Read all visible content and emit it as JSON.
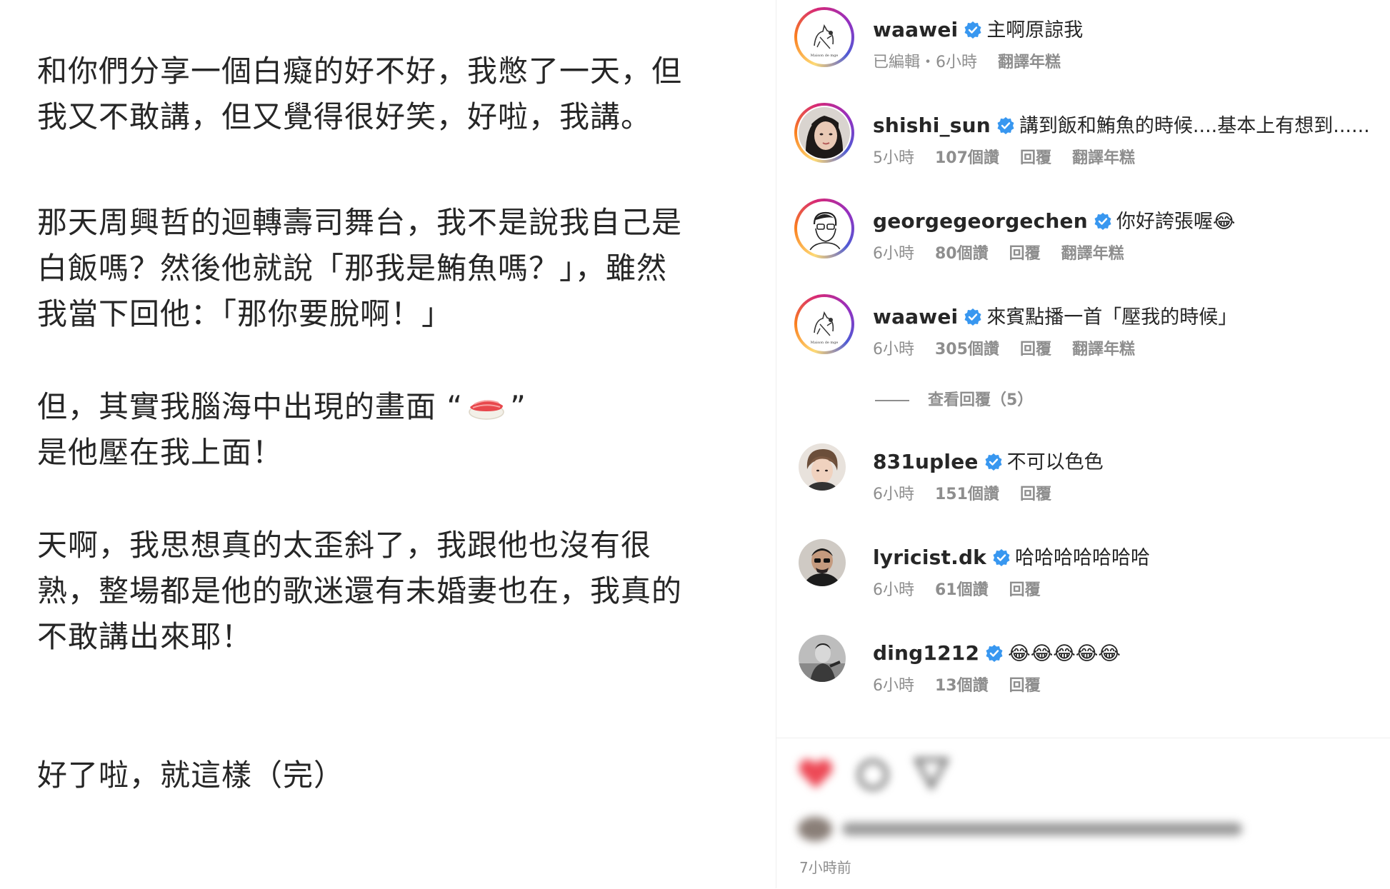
{
  "post": {
    "paragraphs": [
      [
        "和你們分享一個白癡的好不好，我憋了一天，但",
        "我又不敢講，但又覺得很好笑，好啦，我講。"
      ],
      [
        "那天周興哲的迴轉壽司舞台，我不是說我自己是",
        "白飯嗎？然後他就說「那我是鮪魚嗎？」，雖然",
        "我當下回他：「那你要脫啊！」"
      ],
      [
        "但，其實我腦海中出現的畫面 “",
        "是他壓在我上面！"
      ],
      [
        "天啊，我思想真的太歪斜了，我跟他也沒有很",
        "熟，整場都是他的歌迷還有未婚妻也在，我真的",
        "不敢講出來耶！"
      ],
      [
        "好了啦，就這樣（完）"
      ]
    ],
    "sushi_close": "”"
  },
  "comments": [
    {
      "user": "waawei",
      "text": "主啊原諒我",
      "meta": [
        "已編輯・6小時",
        "翻譯年糕"
      ],
      "avatar": "cat-sketch-avatar"
    },
    {
      "user": "shishi_sun",
      "text": "講到飯和鮪魚的時候....基本上有想到......",
      "meta": [
        "5小時",
        "107個讚",
        "回覆",
        "翻譯年糕"
      ],
      "avatar": "woman-photo-avatar"
    },
    {
      "user": "georgegeorgechen",
      "text": "你好誇張喔😂",
      "meta": [
        "6小時",
        "80個讚",
        "回覆",
        "翻譯年糕"
      ],
      "avatar": "line-portrait-avatar"
    },
    {
      "user": "waawei",
      "text": "來賓點播一首「壓我的時候」",
      "meta": [
        "6小時",
        "305個讚",
        "回覆",
        "翻譯年糕"
      ],
      "avatar": "cat-sketch-avatar"
    },
    {
      "user": "831uplee",
      "text": "不可以色色",
      "meta": [
        "6小時",
        "151個讚",
        "回覆"
      ],
      "avatar": "man-photo-avatar"
    },
    {
      "user": "lyricist.dk",
      "text": "哈哈哈哈哈哈哈",
      "meta": [
        "6小時",
        "61個讚",
        "回覆"
      ],
      "avatar": "man-dark-avatar"
    },
    {
      "user": "ding1212",
      "text": "😂😂😂😂😂",
      "meta": [
        "6小時",
        "13個讚",
        "回覆"
      ],
      "avatar": "man-bw-avatar"
    }
  ],
  "view_replies": "查看回覆（5）",
  "footer": {
    "time_ago": "7小時前"
  },
  "colors": {
    "text": "#262626",
    "muted": "#8e8e8e",
    "verified": "#3897f0",
    "like": "#ed4956"
  }
}
